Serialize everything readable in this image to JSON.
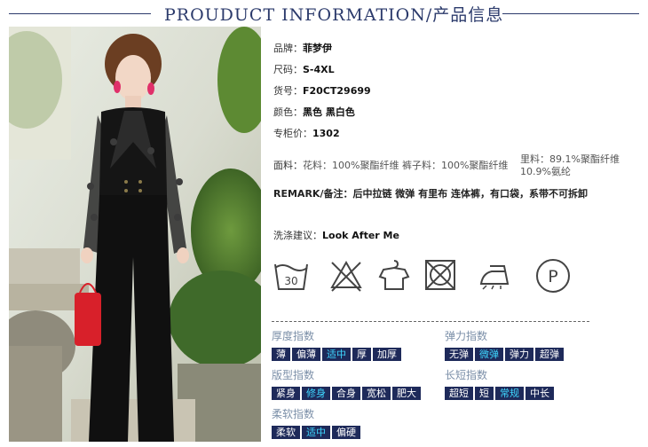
{
  "header": {
    "title": "PROUDUCT INFORMATION/产品信息"
  },
  "info": {
    "brand": {
      "key": "品牌：",
      "value": "菲梦伊"
    },
    "size": {
      "key": "尺码：",
      "value": "S-4XL"
    },
    "item_no": {
      "key": "货号：",
      "value": "F20CT29699"
    },
    "color": {
      "key": "颜色：",
      "value": "黑色  黑白色"
    },
    "price": {
      "key": "专柜价：",
      "value": "1302"
    },
    "fabric": {
      "key": "面料：",
      "main": "花料：100%聚酯纤维  裤子料：100%聚酯纤维",
      "lining_1": "里料：89.1%聚酯纤维",
      "lining_2": "10.9%氨纶"
    },
    "remark": "REMARK/备注：后中拉链 微弹 有里布 连体裤，有口袋，系带不可拆卸",
    "wash": {
      "key": "洗涤建议：",
      "value": "Look After Me"
    }
  },
  "care_icons": {
    "wash_temp": "30",
    "icons": [
      "wash-30-icon",
      "no-bleach-icon",
      "hang-dry-icon",
      "no-tumble-dry-icon",
      "iron-icon",
      "dry-clean-p-icon"
    ],
    "p_letter": "P"
  },
  "indices": {
    "thickness": {
      "title": "厚度指数",
      "options": [
        "薄",
        "偏薄",
        "适中",
        "厚",
        "加厚"
      ],
      "selected": "适中"
    },
    "elasticity": {
      "title": "弹力指数",
      "options": [
        "无弹",
        "微弹",
        "弹力",
        "超弹"
      ],
      "selected": "微弹"
    },
    "fit": {
      "title": "版型指数",
      "options": [
        "紧身",
        "修身",
        "合身",
        "宽松",
        "肥大"
      ],
      "selected": "修身"
    },
    "length": {
      "title": "长短指数",
      "options": [
        "超短",
        "短",
        "常规",
        "中长"
      ],
      "selected": "常规"
    },
    "softness": {
      "title": "柔软指数",
      "options": [
        "柔软",
        "适中",
        "偏硬"
      ],
      "selected": "适中"
    }
  },
  "colors": {
    "navy": "#1e2a5a",
    "selected_text": "#3fd7ff",
    "title_blue": "#2b3a6b"
  }
}
